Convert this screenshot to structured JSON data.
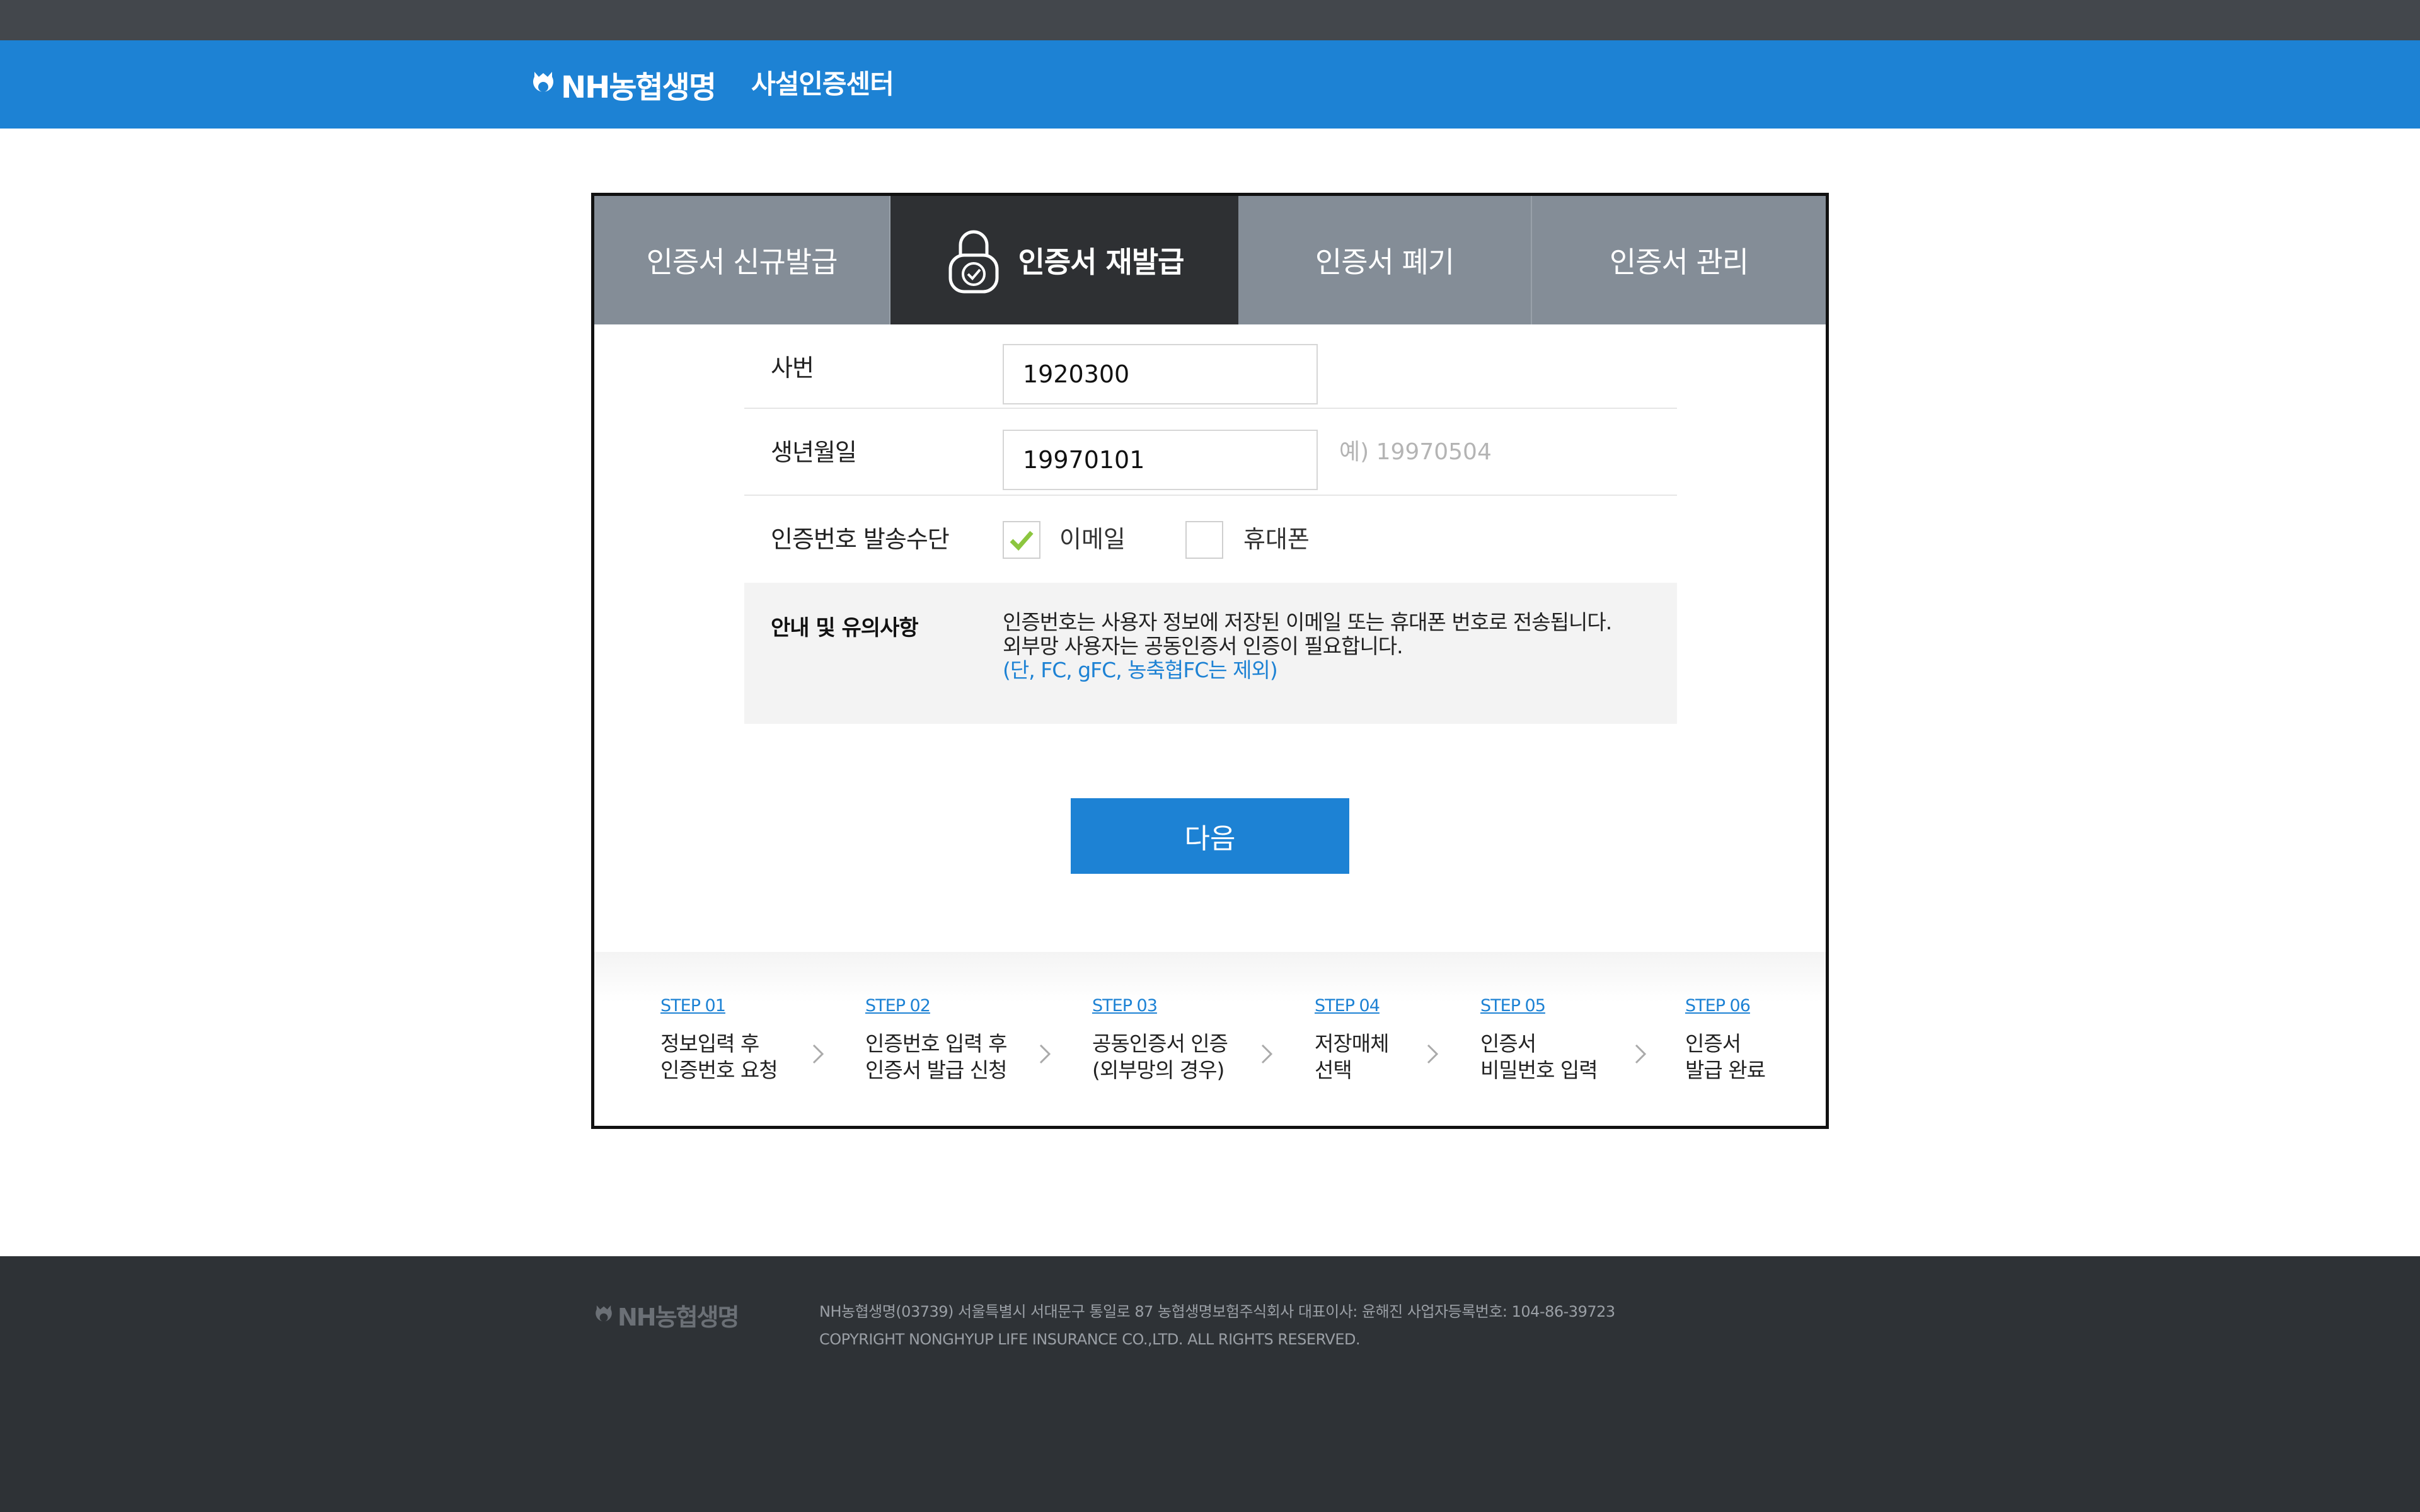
{
  "header": {
    "logo_text": "NH농협생명",
    "center_name": "사설인증센터"
  },
  "tabs": [
    {
      "label": "인증서 신규발급",
      "active": false
    },
    {
      "label": "인증서 재발급",
      "active": true
    },
    {
      "label": "인증서 폐기",
      "active": false
    },
    {
      "label": "인증서 관리",
      "active": false
    }
  ],
  "form": {
    "employee_no": {
      "label": "사번",
      "value": "1920300"
    },
    "birthdate": {
      "label": "생년월일",
      "value": "19970101",
      "hint": "예) 19970504"
    },
    "send_method": {
      "label": "인증번호 발송수단",
      "options": [
        {
          "label": "이메일",
          "checked": true
        },
        {
          "label": "휴대폰",
          "checked": false
        }
      ]
    },
    "notice": {
      "title": "안내 및 유의사항",
      "line1": "인증번호는 사용자 정보에 저장된 이메일 또는 휴대폰 번호로 전송됩니다.",
      "line2": "외부망 사용자는 공동인증서 인증이 필요합니다.",
      "line3": "(단, FC, gFC, 농축협FC는 제외)"
    },
    "next_label": "다음"
  },
  "steps": [
    {
      "num": "STEP 01",
      "text": "정보입력 후\n인증번호 요청"
    },
    {
      "num": "STEP 02",
      "text": "인증번호 입력 후\n인증서 발급 신청"
    },
    {
      "num": "STEP 03",
      "text": "공동인증서 인증\n(외부망의 경우)"
    },
    {
      "num": "STEP 04",
      "text": "저장매체\n선택"
    },
    {
      "num": "STEP 05",
      "text": "인증서\n비밀번호 입력"
    },
    {
      "num": "STEP 06",
      "text": "인증서\n발급 완료"
    }
  ],
  "footer": {
    "logo_text": "NH농협생명",
    "address": "NH농협생명(03739) 서울특별시 서대문구 통일로 87 농협생명보험주식회사 대표이사: 윤해진 사업자등록번호: 104-86-39723",
    "copyright": "COPYRIGHT NONGHYUP LIFE INSURANCE CO.,LTD. ALL RIGHTS RESERVED."
  },
  "colors": {
    "brand_blue": "#1d82d4",
    "tab_inactive": "#848d97",
    "tab_active": "#2e3033",
    "footer_bg": "#2e3236",
    "check_green": "#8cc63f"
  },
  "icons": [
    "nh-logo-icon",
    "lock-check-icon",
    "check-icon",
    "chevron-right-icon"
  ]
}
